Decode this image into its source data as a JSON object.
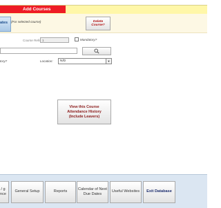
{
  "window": {
    "title": "Add Courses"
  },
  "header": {
    "dates_button": "ates",
    "selected_course_note": "(For selected course)",
    "delete_button": "Delete Course?"
  },
  "form": {
    "course_reference_label": "Course Reference",
    "course_reference_value": "1",
    "mandatory_checkbox_label": "Mandatory?",
    "search_icon": "search-icon",
    "mandatory_question": "tory?",
    "location_label": "Location:",
    "location_value": "N/D"
  },
  "main": {
    "history_button": "View this Course Attendance History (Include Leavers)"
  },
  "footer": {
    "buttons": [
      "/ g nce",
      "General Setup",
      "Reports",
      "Calendar of Next Due Dates",
      "Useful Websites",
      "Exit Database"
    ]
  },
  "colors": {
    "title_red": "#ee1c25",
    "title_bar_yellow": "#fff7a8",
    "history_text": "#8b1a1a",
    "footer_bg": "#dbe6f2"
  }
}
